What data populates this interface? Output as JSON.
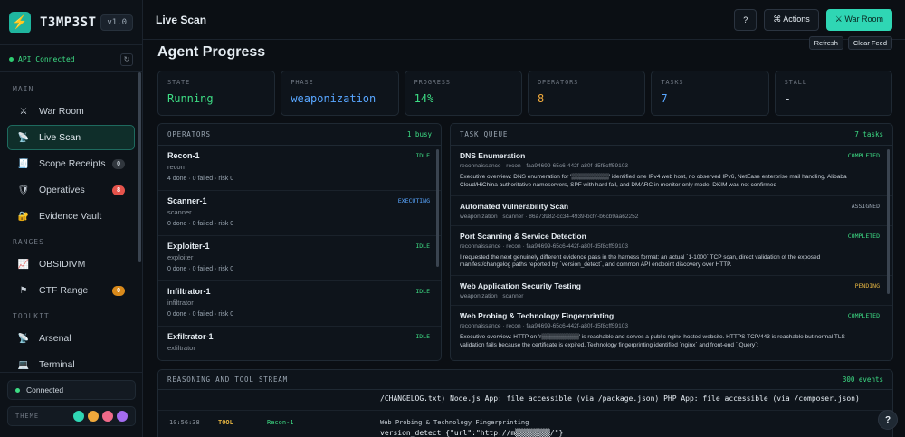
{
  "app": {
    "name": "T3MP3ST",
    "version": "v1.0"
  },
  "api_status": "API Connected",
  "sidebar": {
    "sections": [
      {
        "label": "MAIN",
        "items": [
          {
            "label": "War Room",
            "icon": "crossed-swords-icon",
            "glyph": "⚔"
          },
          {
            "label": "Live Scan",
            "icon": "satellite-icon",
            "glyph": "📡",
            "active": true
          },
          {
            "label": "Scope Receipts",
            "icon": "receipt-icon",
            "glyph": "🧾",
            "badge": "0",
            "badge_color": "gray"
          },
          {
            "label": "Operatives",
            "icon": "shield-icon",
            "glyph": "🛡",
            "badge": "8",
            "badge_color": "red"
          },
          {
            "label": "Evidence Vault",
            "icon": "vault-icon",
            "glyph": "🔐"
          }
        ]
      },
      {
        "label": "RANGES",
        "items": [
          {
            "label": "OBSIDIVM",
            "icon": "chart-icon",
            "glyph": "📈"
          },
          {
            "label": "CTF Range",
            "icon": "flag-icon",
            "glyph": "⚑",
            "badge": "0",
            "badge_color": "orange"
          }
        ]
      },
      {
        "label": "TOOLKIT",
        "items": [
          {
            "label": "Arsenal",
            "icon": "satellite-dish-icon",
            "glyph": "📡"
          },
          {
            "label": "Terminal",
            "icon": "terminal-icon",
            "glyph": "💻"
          }
        ]
      }
    ],
    "connection": "Connected",
    "theme_label": "THEME",
    "theme_swatches": [
      "#2fd6b4",
      "#f0a93b",
      "#f06a8a",
      "#a46cf0"
    ]
  },
  "header": {
    "title": "Live Scan",
    "help_label": "?",
    "actions_label": "⌘ Actions",
    "war_room_label": "⚔ War Room"
  },
  "page": {
    "title": "Agent Progress",
    "refresh_label": "Refresh",
    "clear_label": "Clear Feed"
  },
  "stats": [
    {
      "label": "STATE",
      "value": "Running",
      "color": "#3ddc84"
    },
    {
      "label": "PHASE",
      "value": "weaponization",
      "color": "#58a6ff"
    },
    {
      "label": "PROGRESS",
      "value": "14%",
      "color": "#3ddc84"
    },
    {
      "label": "OPERATORS",
      "value": "8",
      "color": "#f0a93b"
    },
    {
      "label": "TASKS",
      "value": "7",
      "color": "#58a6ff"
    },
    {
      "label": "STALL",
      "value": "-",
      "color": "#c9d1d9"
    }
  ],
  "operators": {
    "title": "OPERATORS",
    "count": "1 busy",
    "items": [
      {
        "name": "Recon-1",
        "role": "recon",
        "stats": "4 done · 0 failed · risk 0",
        "status": "IDLE"
      },
      {
        "name": "Scanner-1",
        "role": "scanner",
        "stats": "0 done · 0 failed · risk 0",
        "status": "EXECUTING"
      },
      {
        "name": "Exploiter-1",
        "role": "exploiter",
        "stats": "0 done · 0 failed · risk 0",
        "status": "IDLE"
      },
      {
        "name": "Infiltrator-1",
        "role": "infiltrator",
        "stats": "0 done · 0 failed · risk 0",
        "status": "IDLE"
      },
      {
        "name": "Exfiltrator-1",
        "role": "exfiltrator",
        "stats": "",
        "status": "IDLE"
      }
    ]
  },
  "tasks": {
    "title": "TASK QUEUE",
    "count": "7 tasks",
    "items": [
      {
        "name": "DNS Enumeration",
        "meta": "reconnaissance · recon · faa94699-65c6-442f-a80f-d5f8cff59103",
        "desc": "Executive overview: DNS enumeration for '▒▒▒▒▒▒▒▒▒' identified one IPv4 web host, no observed IPv6, NetEase enterprise mail handling, Alibaba Cloud/HiChina authoritative nameservers, SPF with hard fail, and DMARC in monitor-only mode. DKIM was not confirmed",
        "status": "COMPLETED"
      },
      {
        "name": "Automated Vulnerability Scan",
        "meta": "weaponization · scanner · 86a73982-cc34-4939-bcf7-b6cb9aa62252",
        "desc": "",
        "status": "ASSIGNED"
      },
      {
        "name": "Port Scanning & Service Detection",
        "meta": "reconnaissance · recon · faa94699-65c6-442f-a80f-d5f8cff59103",
        "desc": "I requested the next genuinely different evidence pass in the harness format: an actual `1-1000` TCP scan, direct validation of the exposed manifest/changelog paths reported by `version_detect`, and common API endpoint discovery over HTTP.",
        "status": "COMPLETED"
      },
      {
        "name": "Web Application Security Testing",
        "meta": "weaponization · scanner",
        "desc": "",
        "status": "PENDING"
      },
      {
        "name": "Web Probing & Technology Fingerprinting",
        "meta": "reconnaissance · recon · faa94699-65c6-442f-a80f-d5f8cff59103",
        "desc": "Executive overview: HTTP on 'r▒▒▒▒▒▒▒▒▒' is reachable and serves a public nginx-hosted website. HTTPS TCP/443 is reachable but normal TLS validation fails because the certificate is expired. Technology fingerprinting identified `nginx` and front-end `jQuery`;",
        "status": "COMPLETED"
      }
    ]
  },
  "stream": {
    "title": "REASONING AND TOOL STREAM",
    "count": "300 events",
    "line0": "/CHANGELOG.txt) Node.js App: file accessible (via /package.json) PHP App: file accessible (via /composer.json)",
    "time": "10:56:38",
    "kind": "TOOL",
    "agent": "Recon-1",
    "line1": "Web Probing & Technology Fingerprinting",
    "line2": "version_detect {\"url\":\"http://m▒▒▒▒▒▒▒▒/\"}"
  },
  "help_fab": "?"
}
